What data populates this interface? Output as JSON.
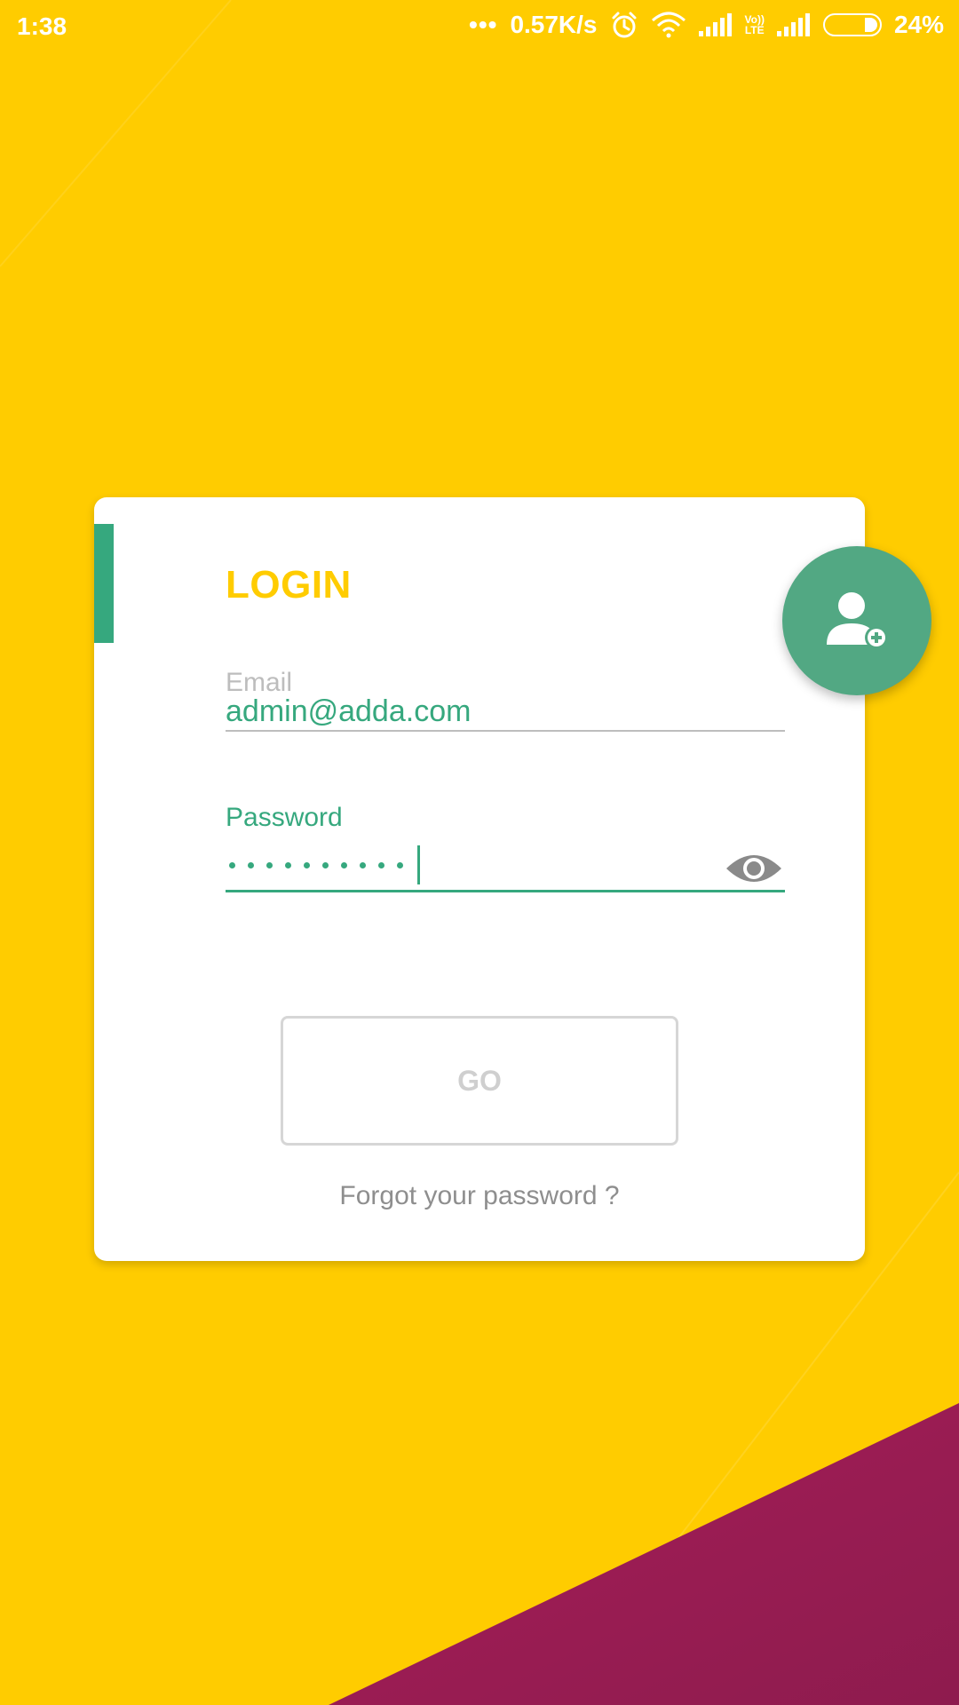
{
  "status_bar": {
    "time": "1:38",
    "dots": "•••",
    "network_speed": "0.57K/s",
    "lte_top": "Vo))",
    "lte_bottom": "LTE",
    "battery": "24%",
    "icons": [
      "alarm-icon",
      "wifi-icon",
      "signal-icon",
      "volte-icon",
      "signal-icon",
      "battery-icon"
    ]
  },
  "login": {
    "title": "LOGIN",
    "email_label": "Email",
    "email_value": "admin@adda.com",
    "password_label": "Password",
    "password_masked_length": 10,
    "go_label": "GO",
    "forgot_label": "Forgot your password ?"
  },
  "icons": {
    "eye": "eye-icon",
    "register": "add-user-icon"
  },
  "colors": {
    "background": "#FFCC00",
    "accent_green": "#36A87E",
    "fab_green": "#52A883",
    "bottom_shape": "#9B1D52",
    "title_yellow": "#FFCC00"
  }
}
